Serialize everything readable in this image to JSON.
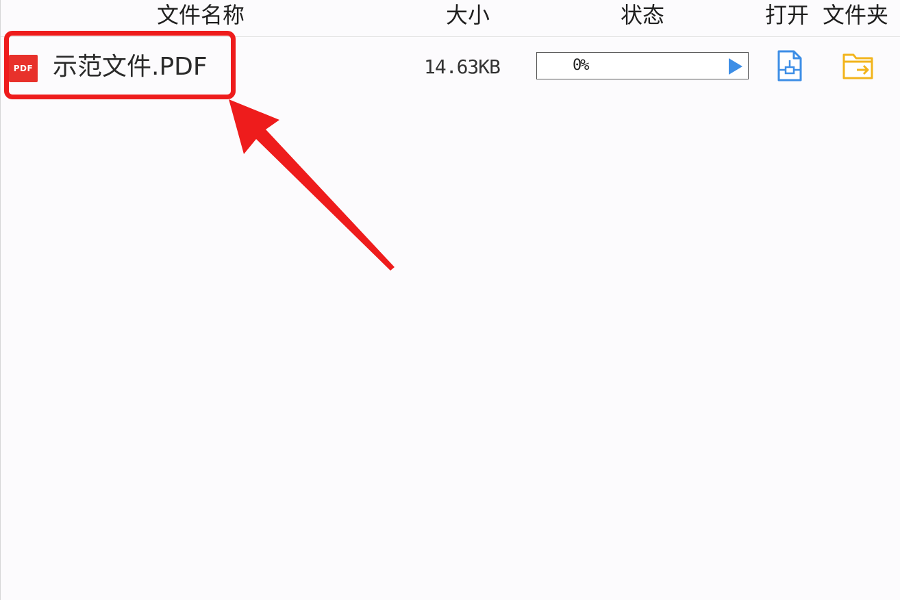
{
  "columns": {
    "name": "文件名称",
    "size": "大小",
    "status": "状态",
    "open": "打开",
    "folder": "文件夹"
  },
  "file": {
    "icon_label": "PDF",
    "name": "示范文件.PDF",
    "size": "14.63KB",
    "progress": 0,
    "progress_text": "0%"
  },
  "icons": {
    "file_type": "pdf-icon",
    "play": "play-icon",
    "open": "document-open-icon",
    "folder": "folder-open-icon"
  },
  "colors": {
    "pdf_red": "#e8312b",
    "accent_blue": "#3d8ee6",
    "folder_yellow": "#f2b41c",
    "annotation_red": "#ee1c1c"
  }
}
